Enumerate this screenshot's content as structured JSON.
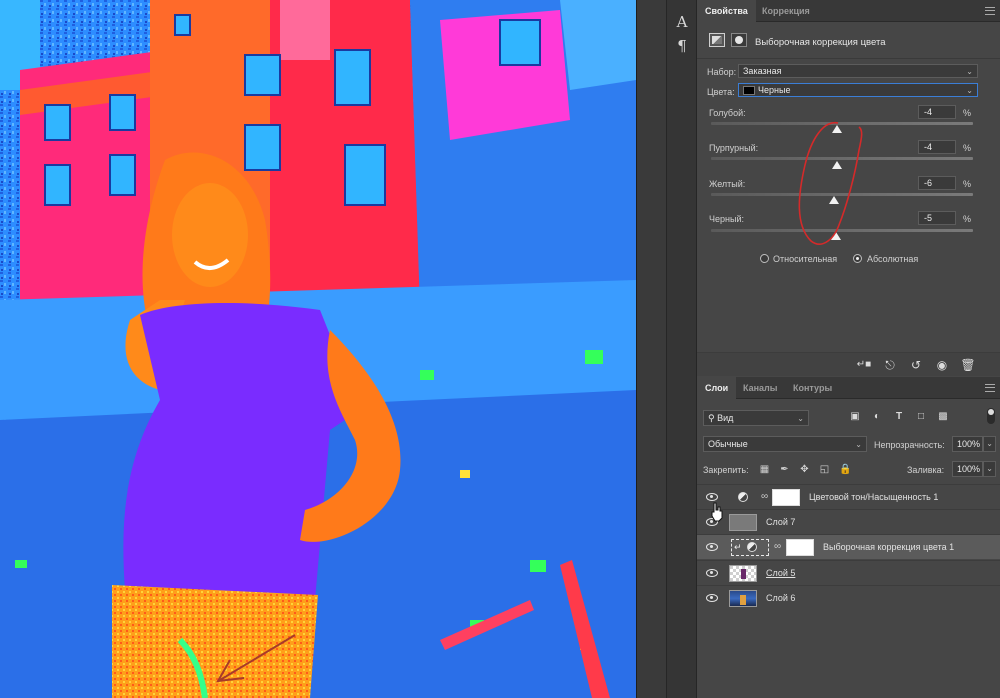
{
  "mini_toolbar": {
    "text_tool_glyph": "A",
    "paragraph_tool_glyph": "¶"
  },
  "properties_panel": {
    "tabs": [
      "Свойства",
      "Коррекция"
    ],
    "header_title": "Выборочная коррекция цвета",
    "preset_label": "Набор:",
    "preset_value": "Заказная",
    "colors_label": "Цвета:",
    "colors_value": "Черные",
    "sliders": [
      {
        "label": "Голубой:",
        "value": "-4",
        "unit": "%",
        "level": -4
      },
      {
        "label": "Пурпурный:",
        "value": "-4",
        "unit": "%",
        "level": -4
      },
      {
        "label": "Желтый:",
        "value": "-6",
        "unit": "%",
        "level": -6
      },
      {
        "label": "Черный:",
        "value": "-5",
        "unit": "%",
        "level": -5
      }
    ],
    "method_relative": "Относительная",
    "method_absolute": "Абсолютная",
    "method_selected": "absolute",
    "footer_icons": [
      "clip-to-layer-icon",
      "view-previous-state-icon",
      "reset-icon",
      "visibility-icon",
      "trash-icon"
    ]
  },
  "layers_panel": {
    "tabs": [
      "Слои",
      "Каналы",
      "Контуры"
    ],
    "filter_kind": "Вид",
    "filter_icons": [
      "image-filter-icon",
      "adjustment-filter-icon",
      "type-filter-icon",
      "shape-filter-icon",
      "smart-object-filter-icon"
    ],
    "blend_mode": "Обычные",
    "opacity_label": "Непрозрачность:",
    "opacity_value": "100%",
    "lock_label": "Закрепить:",
    "lock_icons": [
      "lock-transparent-icon",
      "lock-paint-icon",
      "lock-move-icon",
      "lock-artboard-icon",
      "lock-all-icon"
    ],
    "fill_label": "Заливка:",
    "fill_value": "100%",
    "layers": [
      {
        "name": "Цветовой тон/Насыщенность 1",
        "type": "adjustment",
        "visible": true
      },
      {
        "name": "Слой 7",
        "type": "pixel-gray",
        "visible": true
      },
      {
        "name": "Выборочная коррекция цвета 1",
        "type": "adjustment-clipped",
        "visible": true,
        "selected": true
      },
      {
        "name": "Слой 5",
        "type": "pixel",
        "visible": true
      },
      {
        "name": "Слой 6",
        "type": "pixel",
        "visible": true
      }
    ]
  },
  "colors": {
    "panel_bg": "#464646",
    "tab_bar": "#383838",
    "selected_layer": "#5b5b5b",
    "focus_blue": "#3b7ed6",
    "annotation_red": "#d42a2a"
  }
}
